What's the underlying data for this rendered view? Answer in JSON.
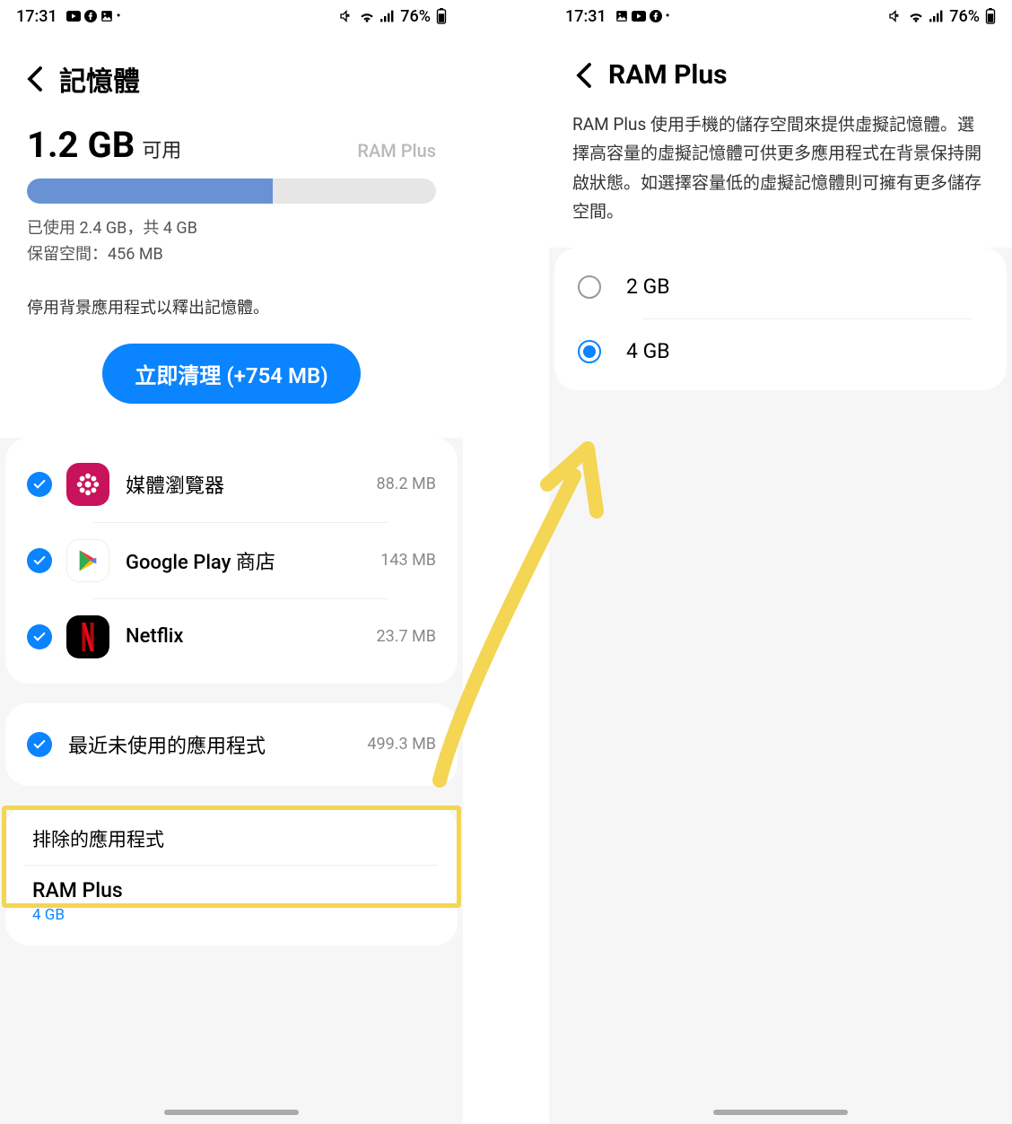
{
  "status": {
    "time": "17:31",
    "battery_text": "76%"
  },
  "left": {
    "title": "記憶體",
    "free_amount": "1.2 GB",
    "free_label": "可用",
    "ram_plus_badge": "RAM Plus",
    "progress_pct": 60,
    "used_line": "已使用 2.4 GB，共 4 GB",
    "reserved_line": "保留空間：456 MB",
    "hint": "停用背景應用程式以釋出記憶體。",
    "cleanup_button": "立即清理 (+754 MB)",
    "apps": [
      {
        "name": "媒體瀏覽器",
        "size": "88.2 MB",
        "icon_bg": "#c9125c",
        "icon": "flower"
      },
      {
        "name": "Google Play 商店",
        "size": "143 MB",
        "icon_bg": "#ffffff",
        "icon": "play"
      },
      {
        "name": "Netflix",
        "size": "23.7 MB",
        "icon_bg": "#000000",
        "icon": "netflix"
      }
    ],
    "recent_unused": {
      "label": "最近未使用的應用程式",
      "size": "499.3 MB"
    },
    "excluded_section_title": "排除的應用程式",
    "ram_plus_item": {
      "title": "RAM Plus",
      "value": "4 GB"
    }
  },
  "right": {
    "title": "RAM Plus",
    "description": "RAM Plus 使用手機的儲存空間來提供虛擬記憶體。選擇高容量的虛擬記憶體可供更多應用程式在背景保持開啟狀態。如選擇容量低的虛擬記憶體則可擁有更多儲存空間。",
    "options": [
      {
        "label": "2 GB",
        "selected": false
      },
      {
        "label": "4 GB",
        "selected": true
      }
    ]
  }
}
